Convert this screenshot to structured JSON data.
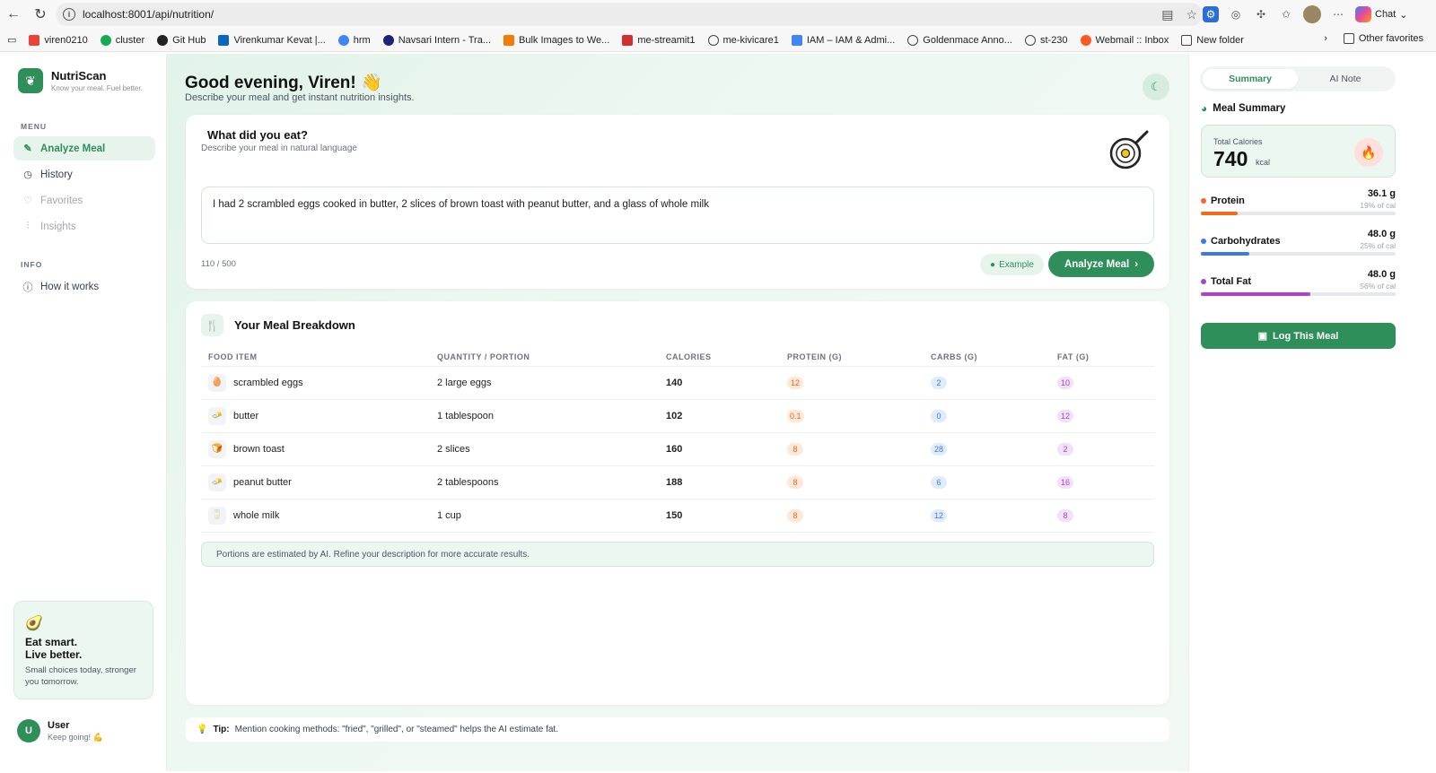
{
  "browser": {
    "url": "localhost:8001/api/nutrition/",
    "chat_label": "Chat",
    "bookmarks": [
      "viren0210",
      "cluster",
      "Git Hub",
      "Virenkumar Kevat |...",
      "hrm",
      "Navsari Intern - Tra...",
      "Bulk Images to We...",
      "me-streamit1",
      "me-kivicare1",
      "IAM – IAM & Admi...",
      "Goldenmace Anno...",
      "st-230",
      "Webmail :: Inbox",
      "New folder"
    ],
    "other_favorites": "Other favorites"
  },
  "sidebar": {
    "brand_name": "NutriScan",
    "brand_tagline": "Know your meal. Fuel better.",
    "menu_label": "MENU",
    "items": [
      {
        "label": "Analyze Meal",
        "icon": "wand-icon"
      },
      {
        "label": "History",
        "icon": "clock-icon"
      },
      {
        "label": "Favorites",
        "icon": "heart-icon"
      },
      {
        "label": "Insights",
        "icon": "chart-icon"
      }
    ],
    "info_label": "INFO",
    "how_it_works": "How it works",
    "promo": {
      "title_1": "Eat smart.",
      "title_2": "Live better.",
      "text": "Small choices today, stronger you tomorrow."
    },
    "user": {
      "initial": "U",
      "name": "User",
      "sub": "Keep going! 💪"
    }
  },
  "main": {
    "greeting": "Good evening, Viren! 👋",
    "greeting_sub": "Describe your meal and get instant nutrition insights.",
    "input_card": {
      "title": "What did you eat?",
      "subtitle": "Describe your meal in natural language",
      "text": "I had 2 scrambled eggs cooked in butter, 2 slices of brown toast with peanut butter, and a glass of whole milk",
      "count": "110 / 500",
      "example_label": "Example",
      "analyze_label": "Analyze Meal"
    },
    "breakdown": {
      "title": "Your Meal Breakdown",
      "columns": [
        "FOOD ITEM",
        "QUANTITY / PORTION",
        "CALORIES",
        "PROTEIN (G)",
        "CARBS (G)",
        "FAT (G)"
      ],
      "rows": [
        {
          "food": "scrambled eggs",
          "icon": "🥚",
          "qty": "2 large eggs",
          "cal": "140",
          "protein": "12",
          "carbs": "2",
          "fat": "10"
        },
        {
          "food": "butter",
          "icon": "🧈",
          "qty": "1 tablespoon",
          "cal": "102",
          "protein": "0.1",
          "carbs": "0",
          "fat": "12"
        },
        {
          "food": "brown toast",
          "icon": "🍞",
          "qty": "2 slices",
          "cal": "160",
          "protein": "8",
          "carbs": "28",
          "fat": "2"
        },
        {
          "food": "peanut butter",
          "icon": "🧈",
          "qty": "2 tablespoons",
          "cal": "188",
          "protein": "8",
          "carbs": "6",
          "fat": "16"
        },
        {
          "food": "whole milk",
          "icon": "🥛",
          "qty": "1 cup",
          "cal": "150",
          "protein": "8",
          "carbs": "12",
          "fat": "8"
        }
      ],
      "note": "Portions are estimated by AI. Refine your description for more accurate results."
    },
    "tip": {
      "label": "Tip:",
      "text": "Mention cooking methods: \"fried\", \"grilled\", or \"steamed\" helps the AI estimate fat."
    }
  },
  "summary": {
    "tabs": [
      "Summary",
      "AI Note"
    ],
    "title": "Meal Summary",
    "total_label": "Total Calories",
    "total_value": "740",
    "total_unit": "kcal",
    "macros": [
      {
        "name": "Protein",
        "value": "36.1 g",
        "pct": "19% of cal",
        "fill": 0.19,
        "color": "#f26b1d"
      },
      {
        "name": "Carbohydrates",
        "value": "48.0 g",
        "pct": "25% of cal",
        "fill": 0.25,
        "color": "#3b7be0"
      },
      {
        "name": "Total Fat",
        "value": "48.0 g",
        "pct": "56% of cal",
        "fill": 0.56,
        "color": "#a845c9"
      }
    ],
    "log_label": "Log This Meal"
  }
}
